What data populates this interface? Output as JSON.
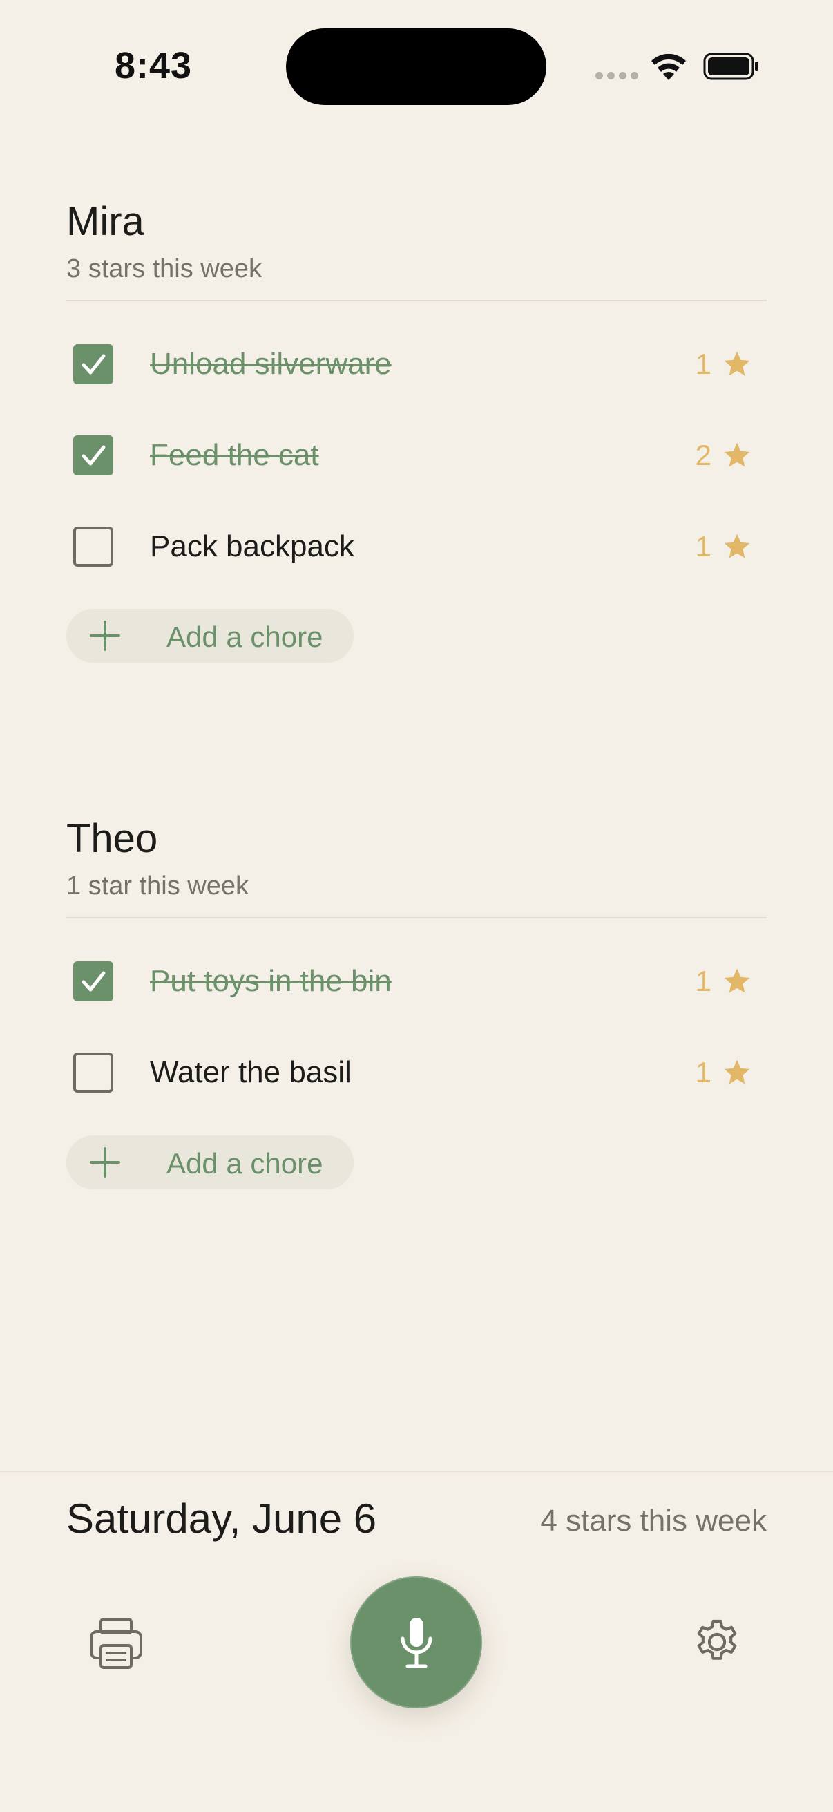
{
  "status_bar": {
    "time": "8:43"
  },
  "sections": [
    {
      "name": "Mira",
      "stars_label": "3 stars this week",
      "chores": [
        {
          "label": "Unload silverware",
          "points": "1",
          "done": true
        },
        {
          "label": "Feed the cat",
          "points": "2",
          "done": true
        },
        {
          "label": "Pack backpack",
          "points": "1",
          "done": false
        }
      ],
      "add_label": "Add a chore"
    },
    {
      "name": "Theo",
      "stars_label": "1 star this week",
      "chores": [
        {
          "label": "Put toys in the bin",
          "points": "1",
          "done": true
        },
        {
          "label": "Water the basil",
          "points": "1",
          "done": false
        }
      ],
      "add_label": "Add a chore"
    }
  ],
  "footer": {
    "date": "Saturday, June 6",
    "total_stars": "4 stars this week"
  },
  "icons": {
    "print": "printer-icon",
    "mic": "microphone-icon",
    "settings": "gear-icon",
    "star": "star-icon",
    "add": "plus-icon"
  },
  "colors": {
    "background": "#f5f0e7",
    "accent_green": "#6b916b",
    "star_gold": "#e2b767",
    "muted_text": "#76716a"
  }
}
